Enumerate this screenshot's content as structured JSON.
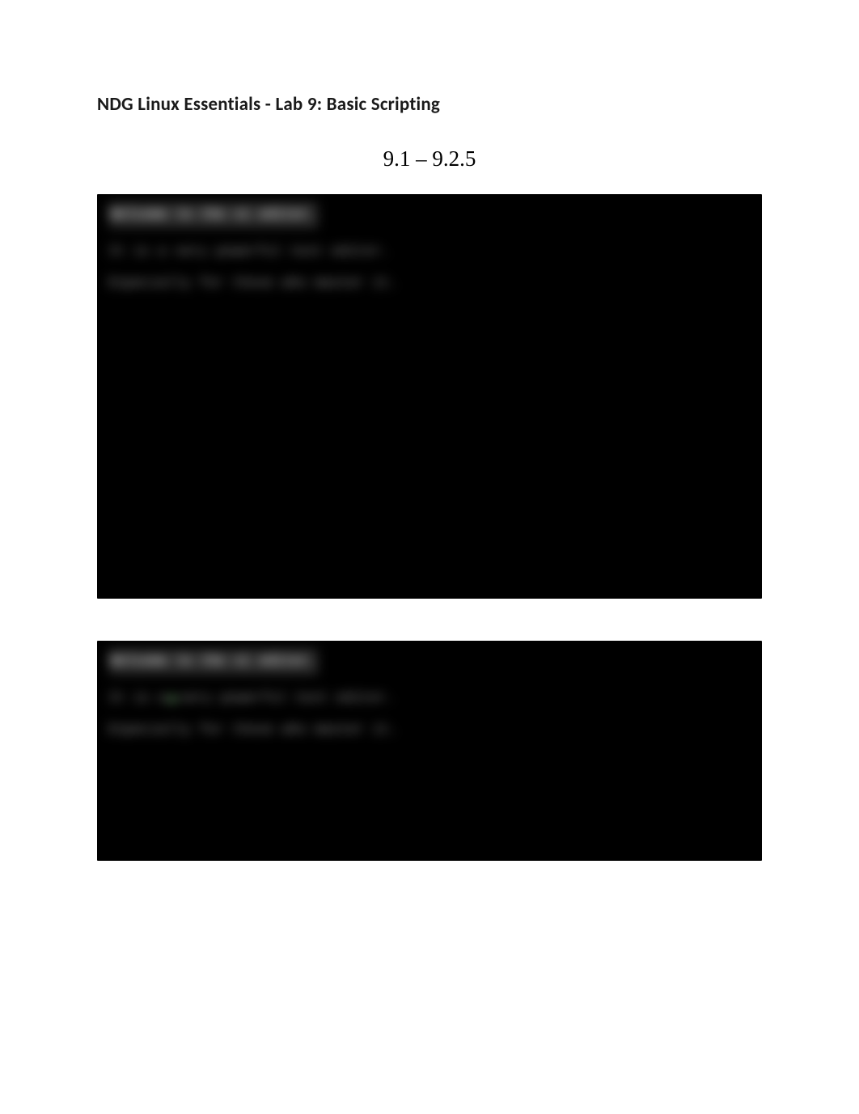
{
  "header": {
    "title": "NDG Linux Essentials - Lab 9: Basic Scripting"
  },
  "section": {
    "range": "9.1 – 9.2.5"
  },
  "terminals": [
    {
      "lines": [
        "Welcome to the vi editor.",
        "It is a very powerful text editor.",
        "Especially for those who master it."
      ]
    },
    {
      "lines": [
        "Welcome to the vi editor.",
        "It is a very powerful text editor.",
        "Especially for those who master it."
      ]
    }
  ]
}
